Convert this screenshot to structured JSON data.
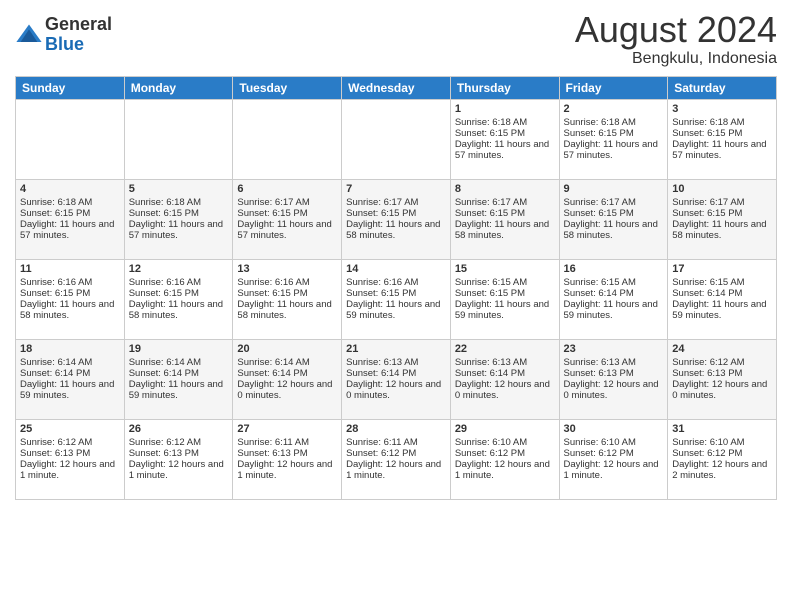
{
  "logo": {
    "general": "General",
    "blue": "Blue"
  },
  "header": {
    "month_year": "August 2024",
    "location": "Bengkulu, Indonesia"
  },
  "days_of_week": [
    "Sunday",
    "Monday",
    "Tuesday",
    "Wednesday",
    "Thursday",
    "Friday",
    "Saturday"
  ],
  "weeks": [
    [
      {
        "day": "",
        "info": ""
      },
      {
        "day": "",
        "info": ""
      },
      {
        "day": "",
        "info": ""
      },
      {
        "day": "",
        "info": ""
      },
      {
        "day": "1",
        "info": "Sunrise: 6:18 AM\nSunset: 6:15 PM\nDaylight: 11 hours and 57 minutes."
      },
      {
        "day": "2",
        "info": "Sunrise: 6:18 AM\nSunset: 6:15 PM\nDaylight: 11 hours and 57 minutes."
      },
      {
        "day": "3",
        "info": "Sunrise: 6:18 AM\nSunset: 6:15 PM\nDaylight: 11 hours and 57 minutes."
      }
    ],
    [
      {
        "day": "4",
        "info": "Sunrise: 6:18 AM\nSunset: 6:15 PM\nDaylight: 11 hours and 57 minutes."
      },
      {
        "day": "5",
        "info": "Sunrise: 6:18 AM\nSunset: 6:15 PM\nDaylight: 11 hours and 57 minutes."
      },
      {
        "day": "6",
        "info": "Sunrise: 6:17 AM\nSunset: 6:15 PM\nDaylight: 11 hours and 57 minutes."
      },
      {
        "day": "7",
        "info": "Sunrise: 6:17 AM\nSunset: 6:15 PM\nDaylight: 11 hours and 58 minutes."
      },
      {
        "day": "8",
        "info": "Sunrise: 6:17 AM\nSunset: 6:15 PM\nDaylight: 11 hours and 58 minutes."
      },
      {
        "day": "9",
        "info": "Sunrise: 6:17 AM\nSunset: 6:15 PM\nDaylight: 11 hours and 58 minutes."
      },
      {
        "day": "10",
        "info": "Sunrise: 6:17 AM\nSunset: 6:15 PM\nDaylight: 11 hours and 58 minutes."
      }
    ],
    [
      {
        "day": "11",
        "info": "Sunrise: 6:16 AM\nSunset: 6:15 PM\nDaylight: 11 hours and 58 minutes."
      },
      {
        "day": "12",
        "info": "Sunrise: 6:16 AM\nSunset: 6:15 PM\nDaylight: 11 hours and 58 minutes."
      },
      {
        "day": "13",
        "info": "Sunrise: 6:16 AM\nSunset: 6:15 PM\nDaylight: 11 hours and 58 minutes."
      },
      {
        "day": "14",
        "info": "Sunrise: 6:16 AM\nSunset: 6:15 PM\nDaylight: 11 hours and 59 minutes."
      },
      {
        "day": "15",
        "info": "Sunrise: 6:15 AM\nSunset: 6:15 PM\nDaylight: 11 hours and 59 minutes."
      },
      {
        "day": "16",
        "info": "Sunrise: 6:15 AM\nSunset: 6:14 PM\nDaylight: 11 hours and 59 minutes."
      },
      {
        "day": "17",
        "info": "Sunrise: 6:15 AM\nSunset: 6:14 PM\nDaylight: 11 hours and 59 minutes."
      }
    ],
    [
      {
        "day": "18",
        "info": "Sunrise: 6:14 AM\nSunset: 6:14 PM\nDaylight: 11 hours and 59 minutes."
      },
      {
        "day": "19",
        "info": "Sunrise: 6:14 AM\nSunset: 6:14 PM\nDaylight: 11 hours and 59 minutes."
      },
      {
        "day": "20",
        "info": "Sunrise: 6:14 AM\nSunset: 6:14 PM\nDaylight: 12 hours and 0 minutes."
      },
      {
        "day": "21",
        "info": "Sunrise: 6:13 AM\nSunset: 6:14 PM\nDaylight: 12 hours and 0 minutes."
      },
      {
        "day": "22",
        "info": "Sunrise: 6:13 AM\nSunset: 6:14 PM\nDaylight: 12 hours and 0 minutes."
      },
      {
        "day": "23",
        "info": "Sunrise: 6:13 AM\nSunset: 6:13 PM\nDaylight: 12 hours and 0 minutes."
      },
      {
        "day": "24",
        "info": "Sunrise: 6:12 AM\nSunset: 6:13 PM\nDaylight: 12 hours and 0 minutes."
      }
    ],
    [
      {
        "day": "25",
        "info": "Sunrise: 6:12 AM\nSunset: 6:13 PM\nDaylight: 12 hours and 1 minute."
      },
      {
        "day": "26",
        "info": "Sunrise: 6:12 AM\nSunset: 6:13 PM\nDaylight: 12 hours and 1 minute."
      },
      {
        "day": "27",
        "info": "Sunrise: 6:11 AM\nSunset: 6:13 PM\nDaylight: 12 hours and 1 minute."
      },
      {
        "day": "28",
        "info": "Sunrise: 6:11 AM\nSunset: 6:12 PM\nDaylight: 12 hours and 1 minute."
      },
      {
        "day": "29",
        "info": "Sunrise: 6:10 AM\nSunset: 6:12 PM\nDaylight: 12 hours and 1 minute."
      },
      {
        "day": "30",
        "info": "Sunrise: 6:10 AM\nSunset: 6:12 PM\nDaylight: 12 hours and 1 minute."
      },
      {
        "day": "31",
        "info": "Sunrise: 6:10 AM\nSunset: 6:12 PM\nDaylight: 12 hours and 2 minutes."
      }
    ]
  ]
}
